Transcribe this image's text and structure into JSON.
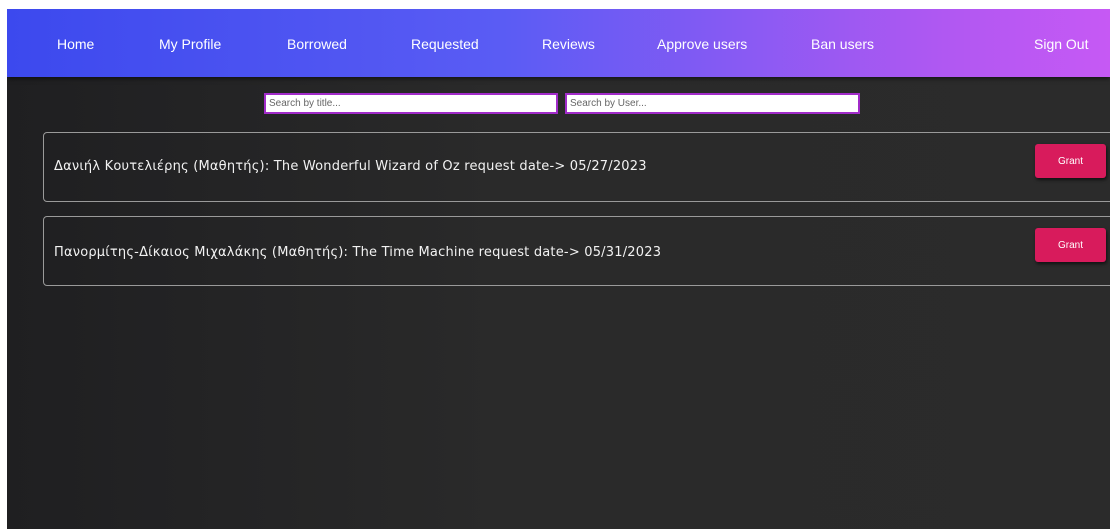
{
  "nav": {
    "home": "Home",
    "profile": "My Profile",
    "borrowed": "Borrowed",
    "requested": "Requested",
    "reviews": "Reviews",
    "approve_users": "Approve users",
    "ban_users": "Ban users",
    "sign_out": "Sign Out"
  },
  "search": {
    "title_placeholder": "Search by title...",
    "user_placeholder": "Search by User..."
  },
  "requests": [
    {
      "text": "Δανιήλ Κουτελιέρης (Μαθητής): The Wonderful Wizard of Oz request date-> 05/27/2023",
      "button": "Grant"
    },
    {
      "text": "Πανορμίτης-Δίκαιος Μιχαλάκης (Μαθητής): The Time Machine request date-> 05/31/2023",
      "button": "Grant"
    }
  ],
  "colors": {
    "nav_gradient_start": "#3c49ee",
    "nav_gradient_end": "#c659f4",
    "grant_button": "#d81b5c",
    "background": "#2a2a2a"
  }
}
